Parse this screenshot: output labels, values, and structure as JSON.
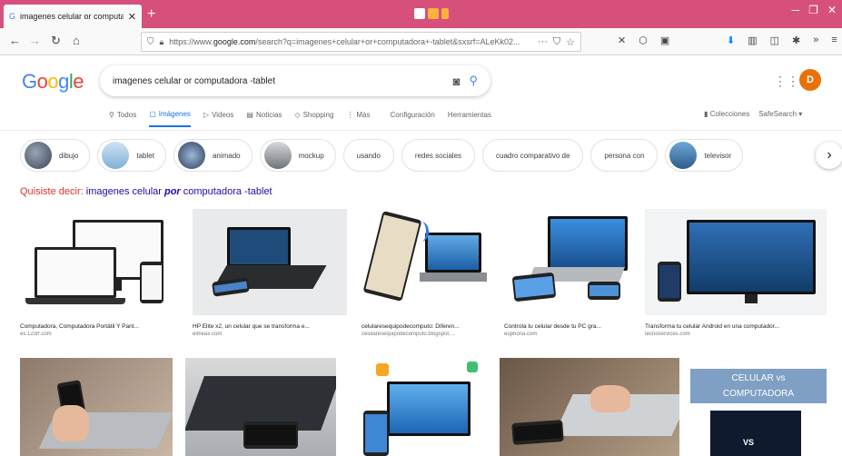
{
  "browser": {
    "tab_title": "imagenes celular or computado...",
    "url_prefix": "https://www.",
    "url_domain": "google.com",
    "url_rest": "/search?q=imagenes+celular+or+computadora+-tablet&sxsrf=ALeKk02..."
  },
  "search": {
    "query": "imagenes celular or computadora -tablet",
    "avatar_letter": "D"
  },
  "nav": {
    "tabs": [
      {
        "label": "Todos",
        "icon": "search-icon"
      },
      {
        "label": "Imágenes",
        "icon": "image-icon",
        "active": true
      },
      {
        "label": "Videos",
        "icon": "video-icon"
      },
      {
        "label": "Noticias",
        "icon": "news-icon"
      },
      {
        "label": "Shopping",
        "icon": "tag-icon"
      },
      {
        "label": "Más",
        "icon": "more-icon"
      },
      {
        "label": "Configuración",
        "icon": ""
      },
      {
        "label": "Herramientas",
        "icon": ""
      }
    ],
    "collections": "Colecciones",
    "safesearch": "SafeSearch ▾"
  },
  "chips": [
    "dibujo",
    "tablet",
    "animado",
    "mockup",
    "usando",
    "redes sociales",
    "cuadro comparativo de",
    "persona con",
    "televisor"
  ],
  "did_you_mean": {
    "label": "Quisiste decir:",
    "before": "imagenes celular",
    "emph": "por",
    "after": "computadora -tablet"
  },
  "results": [
    {
      "caption": "Computadora, Computadora Portátil Y Pant...",
      "source": "es.123rf.com"
    },
    {
      "caption": "HP Elite x2, un celular que se transforma e...",
      "source": "elmeax.com"
    },
    {
      "caption": "celularesequipodecomputo: Diferen...",
      "source": "celularesequipodecomputo.blogspot...."
    },
    {
      "caption": "Controla tu celular desde tu PC gra...",
      "source": "euphoria.com"
    },
    {
      "caption": "Transforma tu celular Android en una computador...",
      "source": "tecnoservices.com"
    }
  ],
  "row2_badge": {
    "line1": "CELULAR vs",
    "line2": "COMPUTADORA",
    "vs": "VS"
  }
}
